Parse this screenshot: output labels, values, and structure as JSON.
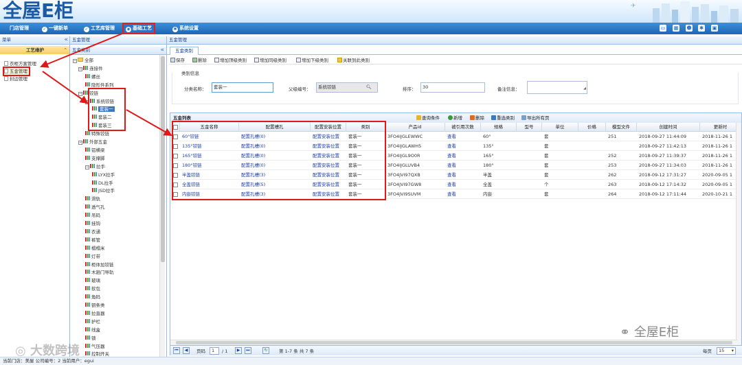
{
  "brand": {
    "logo_text": "全屋E柜",
    "colors": {
      "nav": "#1f6bb9",
      "accent_red": "#e01818",
      "header_blue": "#15428b"
    }
  },
  "nav": {
    "items": [
      {
        "label": "门店管理"
      },
      {
        "label": "一键新单"
      },
      {
        "label": "工艺库管理"
      },
      {
        "label": "基础工艺"
      },
      {
        "label": "系统设置"
      }
    ],
    "active_index": 3
  },
  "toolbar_icons": [
    "monitor-icon",
    "calendar-icon",
    "user-icon",
    "gear-icon",
    "window-icon"
  ],
  "left_panel": {
    "title": "菜单",
    "collapse": "«",
    "submenu_title": "工艺维护",
    "items": [
      {
        "label": "衣柜方案管理"
      },
      {
        "label": "五金管理"
      },
      {
        "label": "封边管理"
      }
    ]
  },
  "tree_panel": {
    "title": "五金管理",
    "sub_title": "五金类别",
    "collapse": "«"
  },
  "tree": [
    {
      "label": "全部",
      "level": 0,
      "type": "folder",
      "toggle": "−"
    },
    {
      "label": "连接件",
      "level": 1,
      "type": "folder",
      "toggle": "−"
    },
    {
      "label": "螺丝",
      "level": 2,
      "type": "leaf"
    },
    {
      "label": "隐形件系列",
      "level": 2,
      "type": "leaf"
    },
    {
      "label": "铰链",
      "level": 1,
      "type": "folder",
      "toggle": "−"
    },
    {
      "label": "系统铰链",
      "level": 2,
      "type": "folder",
      "toggle": "−"
    },
    {
      "label": "套装一",
      "level": 3,
      "type": "leaf"
    },
    {
      "label": "套装二",
      "level": 3,
      "type": "leaf"
    },
    {
      "label": "套装三",
      "level": 3,
      "type": "leaf"
    },
    {
      "label": "特殊铰链",
      "level": 2,
      "type": "leaf"
    },
    {
      "label": "外部五金",
      "level": 1,
      "type": "folder",
      "toggle": "−"
    },
    {
      "label": "铝横梁",
      "level": 2,
      "type": "leaf"
    },
    {
      "label": "支撑脚",
      "level": 2,
      "type": "leaf"
    },
    {
      "label": "拉手",
      "level": 2,
      "type": "folder",
      "toggle": "−"
    },
    {
      "label": "LYX拉手",
      "level": 3,
      "type": "leaf"
    },
    {
      "label": "DL拉手",
      "level": 3,
      "type": "leaf"
    },
    {
      "label": "JSD拉手",
      "level": 3,
      "type": "leaf"
    },
    {
      "label": "滑轨",
      "level": 2,
      "type": "leaf"
    },
    {
      "label": "透气孔",
      "level": 2,
      "type": "leaf"
    },
    {
      "label": "吊码",
      "level": 2,
      "type": "leaf"
    },
    {
      "label": "挂钩",
      "level": 2,
      "type": "leaf"
    },
    {
      "label": "衣通",
      "level": 2,
      "type": "leaf"
    },
    {
      "label": "裤管",
      "level": 2,
      "type": "leaf"
    },
    {
      "label": "榻榻米",
      "level": 2,
      "type": "leaf"
    },
    {
      "label": "灯带",
      "level": 2,
      "type": "leaf"
    },
    {
      "label": "柜体加铰链",
      "level": 2,
      "type": "leaf"
    },
    {
      "label": "木趟门导轨",
      "level": 2,
      "type": "leaf"
    },
    {
      "label": "玻璃",
      "level": 2,
      "type": "leaf"
    },
    {
      "label": "软包",
      "level": 2,
      "type": "leaf"
    },
    {
      "label": "角码",
      "level": 2,
      "type": "leaf"
    },
    {
      "label": "钥条类",
      "level": 2,
      "type": "leaf"
    },
    {
      "label": "拉直器",
      "level": 2,
      "type": "leaf"
    },
    {
      "label": "护栏",
      "level": 2,
      "type": "leaf"
    },
    {
      "label": "线盒",
      "level": 2,
      "type": "leaf"
    },
    {
      "label": "锁",
      "level": 2,
      "type": "leaf"
    },
    {
      "label": "气压器",
      "level": 2,
      "type": "leaf"
    },
    {
      "label": "控制开关",
      "level": 2,
      "type": "leaf"
    }
  ],
  "tab": {
    "label": "五金类别"
  },
  "actions": [
    {
      "label": "保存"
    },
    {
      "label": "删除"
    },
    {
      "label": "增加顶级类别"
    },
    {
      "label": "增加同级类别"
    },
    {
      "label": "增加下级类别"
    },
    {
      "label": "关联到此类别"
    }
  ],
  "form": {
    "section_title": "类别信息",
    "category_name_label": "分类名称：",
    "category_name_value": "套装一",
    "parent_label": "父级编号：",
    "parent_value": "系统铰链",
    "sort_label": "排序：",
    "sort_value": "30",
    "note_label": "备注信息：",
    "note_value": ""
  },
  "grid": {
    "title": "五金列表",
    "buttons": [
      {
        "label": "查询条件",
        "color": "#e9b22b"
      },
      {
        "label": "新增",
        "color": "#3a9a3a"
      },
      {
        "label": "删除",
        "color": "#e06b1e"
      },
      {
        "label": "重选类别",
        "color": "#3c77c4"
      },
      {
        "label": "导出所有页",
        "color": "#7aa0c8"
      }
    ],
    "columns": [
      "五金名称",
      "配置槽孔",
      "配置安装位置",
      "类别",
      "产品id",
      "被引用次数",
      "规格",
      "型号",
      "单位",
      "价格",
      "模型文件",
      "创建时间",
      "更新时"
    ],
    "rows": [
      {
        "name": "60°铰链",
        "slot": "配置孔槽(0)",
        "pos": "配置安装位置",
        "cat": "套装一",
        "pid": "3FO4IJGLEWWC",
        "ref": "查看",
        "spec": "60°",
        "model": "",
        "unit": "套",
        "price": "",
        "file": "251",
        "created": "2018-09-27 11:44:09",
        "updated": "2018-11-26 1"
      },
      {
        "name": "135°铰链",
        "slot": "配置孔槽(0)",
        "pos": "配置安装位置",
        "cat": "套装一",
        "pid": "3FO4IJGLAWH5",
        "ref": "查看",
        "spec": "135°",
        "model": "",
        "unit": "套",
        "price": "",
        "file": "",
        "created": "2018-09-27 11:42:13",
        "updated": "2018-11-26 1"
      },
      {
        "name": "165°铰链",
        "slot": "配置孔槽(0)",
        "pos": "配置安装位置",
        "cat": "套装一",
        "pid": "3FO4IJGL9O0R",
        "ref": "查看",
        "spec": "165°",
        "model": "",
        "unit": "套",
        "price": "",
        "file": "252",
        "created": "2018-09-27 11:39:37",
        "updated": "2018-11-26 1"
      },
      {
        "name": "180°铰链",
        "slot": "配置孔槽(0)",
        "pos": "配置安装位置",
        "cat": "套装一",
        "pid": "3FO4IJGLUVB4",
        "ref": "查看",
        "spec": "180°",
        "model": "",
        "unit": "套",
        "price": "",
        "file": "253",
        "created": "2018-09-27 11:34:03",
        "updated": "2018-11-26 1"
      },
      {
        "name": "半盖铰链",
        "slot": "配置孔槽(3)",
        "pos": "配置安装位置",
        "cat": "套装一",
        "pid": "3FO4JVI97QXB",
        "ref": "查看",
        "spec": "半盖",
        "model": "",
        "unit": "套",
        "price": "",
        "file": "262",
        "created": "2018-09-12 17:31:27",
        "updated": "2020-09-05 1"
      },
      {
        "name": "全盖铰链",
        "slot": "配置孔槽(5)",
        "pos": "配置安装位置",
        "cat": "套装一",
        "pid": "3FO4JVI97GW8",
        "ref": "查看",
        "spec": "全盖",
        "model": "",
        "unit": "个",
        "price": "",
        "file": "263",
        "created": "2018-09-12 17:14:32",
        "updated": "2020-09-05 1"
      },
      {
        "name": "内嵌铰链",
        "slot": "配置孔槽(3)",
        "pos": "配置安装位置",
        "cat": "套装一",
        "pid": "3FO4JVI9SUVM",
        "ref": "查看",
        "spec": "内嵌",
        "model": "",
        "unit": "套",
        "price": "",
        "file": "264",
        "created": "2018-09-12 17:11:44",
        "updated": "2020-10-21 1"
      }
    ]
  },
  "pager": {
    "page_label": "页码",
    "page_value": "1",
    "total_pages": "/ 1",
    "range_text": "第 1-7 条  共 7 条",
    "per_page_label": "每页",
    "per_page_value": "15",
    "first": "⏮",
    "prev": "◀",
    "next": "▶",
    "last": "⏭",
    "refresh": "↻"
  },
  "status": {
    "text": "当前门店：美屋  公司编号：2   当前用户：egui"
  },
  "watermarks": {
    "left": "大数跨境",
    "right": "全屋E柜"
  }
}
